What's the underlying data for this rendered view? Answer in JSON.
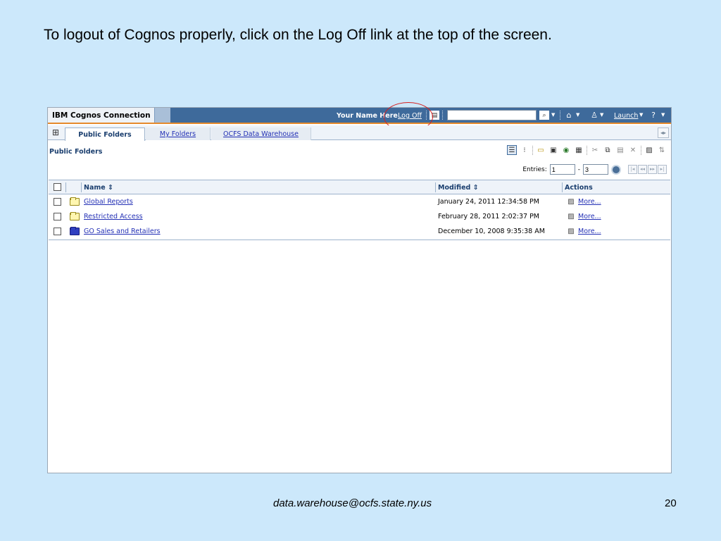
{
  "slide": {
    "title": "To logout of Cognos properly, click on the Log Off link at the top of the screen.",
    "footer_email": "data.warehouse@ocfs.state.ny.us",
    "page_number": "20"
  },
  "banner": {
    "app_name": "IBM Cognos Connection",
    "user_name": "Your Name Here",
    "logoff": "Log Off",
    "search_value": "",
    "launch": "Launch"
  },
  "tabs": [
    {
      "label": "Public Folders",
      "active": true
    },
    {
      "label": "My Folders",
      "active": false
    },
    {
      "label": "OCFS Data Warehouse",
      "active": false
    }
  ],
  "path": {
    "title": "Public Folders"
  },
  "entries": {
    "label": "Entries:",
    "from": "1",
    "dash": "-",
    "to": "3"
  },
  "table": {
    "columns": {
      "name": "Name",
      "modified": "Modified",
      "actions": "Actions"
    },
    "sort_icon": "⇕",
    "rows": [
      {
        "name": "Global Reports",
        "modified": "January 24, 2011 12:34:58 PM",
        "action": "More...",
        "folder_color": "yellow"
      },
      {
        "name": "Restricted Access",
        "modified": "February 28, 2011 2:02:37 PM",
        "action": "More...",
        "folder_color": "yellow"
      },
      {
        "name": "GO Sales and Retailers",
        "modified": "December 10, 2008 9:35:38 AM",
        "action": "More...",
        "folder_color": "blue"
      }
    ]
  },
  "icons": {
    "banner": [
      "my-area-icon",
      "search-options-icon",
      "home-icon",
      "user-icon",
      "help-icon"
    ],
    "toolbar": [
      "details-view-icon",
      "list-view-icon",
      "new-folder-icon",
      "new-job-icon",
      "new-url-icon",
      "new-page-icon",
      "cut-icon",
      "copy-icon",
      "paste-icon",
      "delete-icon",
      "set-properties-icon",
      "order-icon"
    ],
    "row_action": "set-properties-icon"
  },
  "colors": {
    "slide_background": "#cce8fb",
    "banner": "#3e6a9b",
    "banner_accent": "#e58a2c",
    "link": "#2330b5",
    "annotation_circle": "#d42020"
  }
}
